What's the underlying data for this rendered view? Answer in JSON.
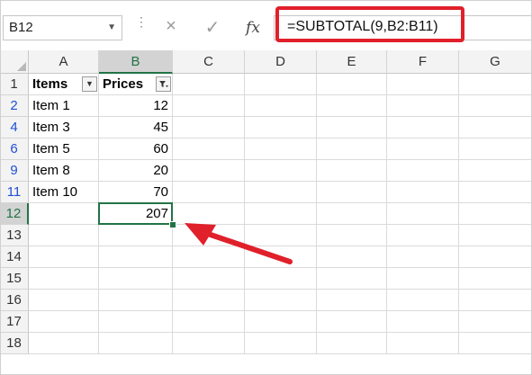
{
  "formula_bar": {
    "name_box": "B12",
    "formula": "=SUBTOTAL(9,B2:B11)",
    "cancel_icon": "×",
    "enter_icon": "✓",
    "fx_label": "fx"
  },
  "columns": [
    "A",
    "B",
    "C",
    "D",
    "E",
    "F",
    "G"
  ],
  "rows": [
    "1",
    "2",
    "4",
    "6",
    "9",
    "11",
    "12",
    "13",
    "14",
    "15",
    "16",
    "17",
    "18"
  ],
  "filtered_rows": [
    "2",
    "4",
    "6",
    "9",
    "11"
  ],
  "selected_cell": "B12",
  "headers": {
    "a1": "Items",
    "b1": "Prices"
  },
  "data_rows": [
    {
      "item": "Item 1",
      "price": "12"
    },
    {
      "item": "Item 3",
      "price": "45"
    },
    {
      "item": "Item 5",
      "price": "60"
    },
    {
      "item": "Item 8",
      "price": "20"
    },
    {
      "item": "Item 10",
      "price": "70"
    }
  ],
  "total": "207",
  "colors": {
    "highlight": "#e0202a",
    "selection": "#217346",
    "filtered_row_number": "#1f4fd6"
  },
  "icons": {
    "items_filter": "dropdown-arrow-icon",
    "prices_filter": "filter-active-icon",
    "annotation": "red-arrow"
  }
}
